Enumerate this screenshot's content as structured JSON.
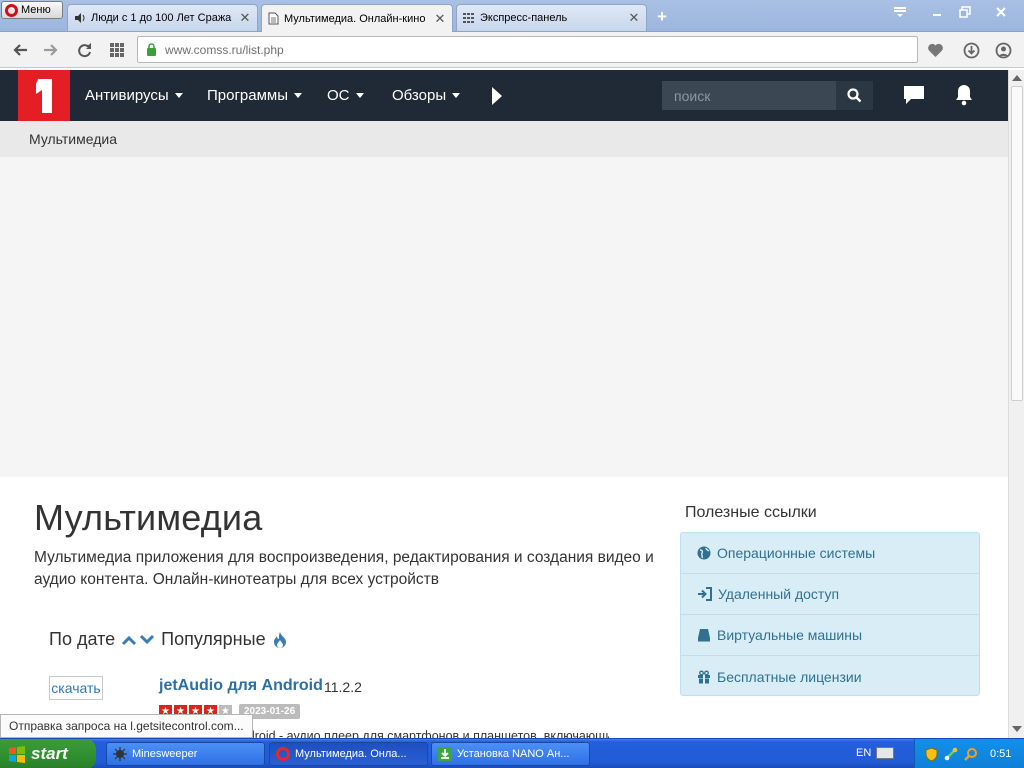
{
  "browser": {
    "menu_label": "Меню",
    "tabs": [
      {
        "title": "Люди с 1 до 100 Лет Сража",
        "icon": "speaker-icon"
      },
      {
        "title": "Мультимедиа. Онлайн-кино",
        "icon": "page-icon"
      },
      {
        "title": "Экспресс-панель",
        "icon": "grid-icon"
      }
    ],
    "url_host": "www.comss.ru",
    "url_path": "/list.php"
  },
  "site": {
    "logo_text": "1",
    "nav": [
      {
        "label": "Антивирусы"
      },
      {
        "label": "Программы"
      },
      {
        "label": "ОС"
      },
      {
        "label": "Обзоры"
      }
    ],
    "search_placeholder": "поиск"
  },
  "breadcrumb": "Мультимедиа",
  "content": {
    "heading": "Мультимедиа",
    "description": "Мультимедиа приложения для воспроизведения, редактирования и создания видео и аудио контента. Онлайн-кинотеатры для всех устройств",
    "sort_date": "По дате",
    "sort_popular": "Популярные",
    "item": {
      "download_label": "скачать",
      "title": "jetAudio для Android",
      "version": "11.2.2",
      "rating": 4,
      "rating_max": 5,
      "date": "2023-01-26",
      "desc": "jetAudio для Android - аудио плеер для смартфонов и планшетов, включающий"
    }
  },
  "sidebar": {
    "title": "Полезные ссылки",
    "links": [
      {
        "label": "Операционные системы",
        "icon": "globe-icon"
      },
      {
        "label": "Удаленный доступ",
        "icon": "sign-in-icon"
      },
      {
        "label": "Виртуальные машины",
        "icon": "server-icon"
      },
      {
        "label": "Бесплатные лицензии",
        "icon": "gift-icon"
      }
    ]
  },
  "status_text": "Отправка запроса на l.getsitecontrol.com...",
  "taskbar": {
    "start_label": "start",
    "tasks": [
      {
        "label": "Minesweeper"
      },
      {
        "label": "Мультимедиа. Онла..."
      },
      {
        "label": "Установка NANO Ан..."
      }
    ],
    "lang": "EN",
    "clock": "0:51"
  }
}
